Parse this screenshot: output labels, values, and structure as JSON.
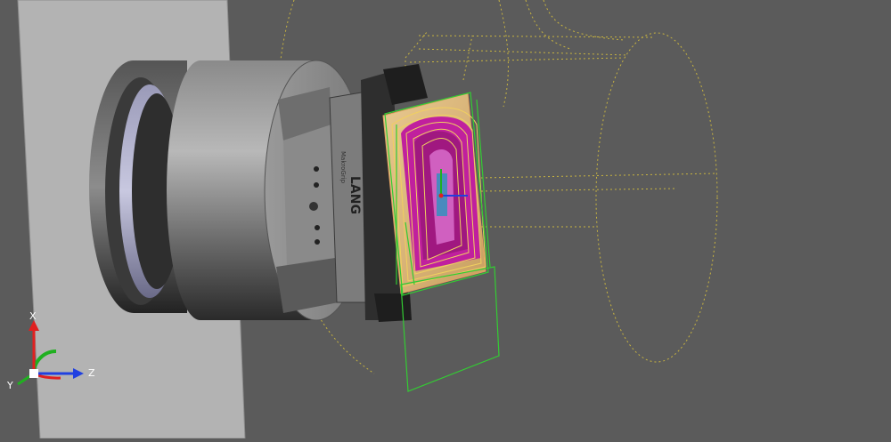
{
  "viewport": {
    "background": "#5b5b5b",
    "machine_wall_color": "#b0b0b0",
    "toolpath_color": "#e6c23a",
    "selection_color": "#33cc33",
    "fixture_brand": "LANG",
    "fixture_model": "MakroGrip"
  },
  "triad": {
    "x_label": "X",
    "y_label": "Y",
    "z_label": "Z",
    "x_color": "#e02020",
    "y_color": "#20b020",
    "z_color": "#2040e0"
  }
}
